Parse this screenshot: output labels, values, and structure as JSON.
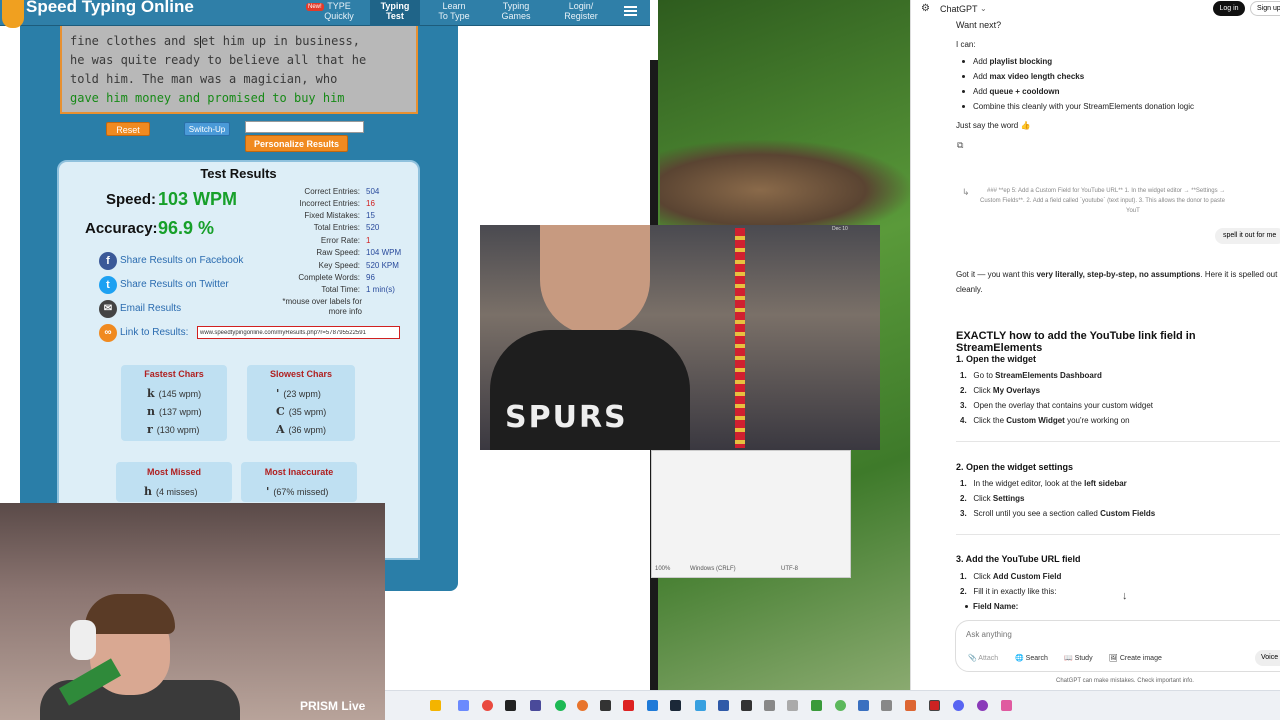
{
  "speedtyping": {
    "site_title": "Speed Typing Online",
    "nav": {
      "badge": "New!",
      "items": [
        "TYPE\nQuickly",
        "Typing\nTest",
        "Learn\nTo Type",
        "Typing\nGames",
        "Login/\nRegister"
      ],
      "active_index": 1
    },
    "passage": {
      "line1_done": "fine clothes and s",
      "line1_rest": "et him up in business,",
      "line2": "he was quite ready to believe all that he",
      "line3": "told him. The man was a magician, who",
      "line4": "gave him money and promised to buy him"
    },
    "controls": {
      "reset": "Reset",
      "switch_up": "Switch-Up",
      "personalize": "Personalize Results",
      "input_value": ""
    },
    "results": {
      "heading": "Test Results",
      "speed_label": "Speed:",
      "speed_value": "103 WPM",
      "accuracy_label": "Accuracy:",
      "accuracy_value": "96.9 %",
      "stats": [
        {
          "label": "Correct Entries:",
          "value": "504"
        },
        {
          "label": "Incorrect Entries:",
          "value": "16"
        },
        {
          "label": "Fixed Mistakes:",
          "value": "15"
        },
        {
          "label": "Total Entries:",
          "value": "520"
        },
        {
          "label": "Error Rate:",
          "value": "1"
        },
        {
          "label": "Raw Speed:",
          "value": "104 WPM"
        },
        {
          "label": "Key Speed:",
          "value": "520 KPM"
        },
        {
          "label": "Complete Words:",
          "value": "96"
        },
        {
          "label": "Total Time:",
          "value": "1 min(s)"
        }
      ],
      "note_line1": "*mouse over labels for",
      "note_line2": "more info",
      "share_facebook": "Share Results on Facebook",
      "share_twitter": "Share Results on Twitter",
      "email": "Email Results",
      "link_label": "Link to Results:",
      "link_value": "www.speedtypingonline.com/myResults.php?r=578795522591",
      "fastest_heading": "Fastest Chars",
      "fastest": [
        {
          "char": "k",
          "wpm": "(145 wpm)"
        },
        {
          "char": "n",
          "wpm": "(137 wpm)"
        },
        {
          "char": "r",
          "wpm": "(130 wpm)"
        }
      ],
      "slowest_heading": "Slowest Chars",
      "slowest": [
        {
          "char": "'",
          "wpm": "(23 wpm)"
        },
        {
          "char": "C",
          "wpm": "(35 wpm)"
        },
        {
          "char": "A",
          "wpm": "(36 wpm)"
        }
      ],
      "missed_heading": "Most Missed",
      "missed": [
        {
          "char": "h",
          "info": "(4 misses)"
        }
      ],
      "inaccurate_heading": "Most Inaccurate",
      "inaccurate": [
        {
          "char": "'",
          "info": "(67% missed)"
        }
      ]
    }
  },
  "webcam": {
    "watermark": "PRISM Live"
  },
  "video": {
    "shirt_text": "SPURS",
    "timestamp": "Dec 10"
  },
  "notepad": {
    "zoom": "100%",
    "line_ending": "Windows (CRLF)",
    "encoding": "UTF-8"
  },
  "chatgpt": {
    "brand": "ChatGPT",
    "login": "Log in",
    "signup": "Sign up",
    "want_next": "Want next?",
    "i_can": "I can:",
    "options": [
      {
        "pre": "Add ",
        "bold": "playlist blocking",
        "post": ""
      },
      {
        "pre": "Add ",
        "bold": "max video length checks",
        "post": ""
      },
      {
        "pre": "Add ",
        "bold": "queue + cooldown",
        "post": ""
      },
      {
        "pre": "Combine this cleanly with your StreamElements donation logic",
        "bold": "",
        "post": ""
      }
    ],
    "say_word": "Just say the word 👍",
    "quoted_line1": "### **ep 5: Add a Custom Field for YouTube URL** 1. In the widget editor → **Settings →",
    "quoted_line2": "Custom Fields**. 2. Add a field called `youtube` (text input). 3. This allows the donor to paste",
    "quoted_line3": "YouT",
    "user_message": "spell it out for me",
    "reply_line1_pre": "Got it — you want this ",
    "reply_line1_bold": "very literally, step-by-step, no assumptions",
    "reply_line1_post": ". Here it is spelled out",
    "reply_line2": "cleanly.",
    "heading": "EXACTLY how to add the YouTube link field in StreamElements",
    "s1_title": "1. Open the widget",
    "s1_items": [
      {
        "pre": "Go to ",
        "bold": "StreamElements Dashboard",
        "post": ""
      },
      {
        "pre": "Click ",
        "bold": "My Overlays",
        "post": ""
      },
      {
        "pre": "Open the overlay that contains your custom widget",
        "bold": "",
        "post": ""
      },
      {
        "pre": "Click the ",
        "bold": "Custom Widget",
        "post": " you're working on"
      }
    ],
    "s2_title": "2. Open the widget settings",
    "s2_items": [
      {
        "pre": "In the widget editor, look at the ",
        "bold": "left sidebar",
        "post": ""
      },
      {
        "pre": "Click ",
        "bold": "Settings",
        "post": ""
      },
      {
        "pre": "Scroll until you see a section called ",
        "bold": "Custom Fields",
        "post": ""
      }
    ],
    "s3_title": "3. Add the YouTube URL field",
    "s3_items": [
      {
        "pre": "Click ",
        "bold": "Add Custom Field",
        "post": ""
      },
      {
        "pre": "Fill it in exactly like this:",
        "bold": "",
        "post": ""
      }
    ],
    "field_name": "Field Name:",
    "input_placeholder": "Ask anything",
    "buttons": [
      "Attach",
      "Search",
      "Study",
      "Create image"
    ],
    "voice": "Voice",
    "disclaimer": "ChatGPT can make mistakes. Check important info."
  }
}
